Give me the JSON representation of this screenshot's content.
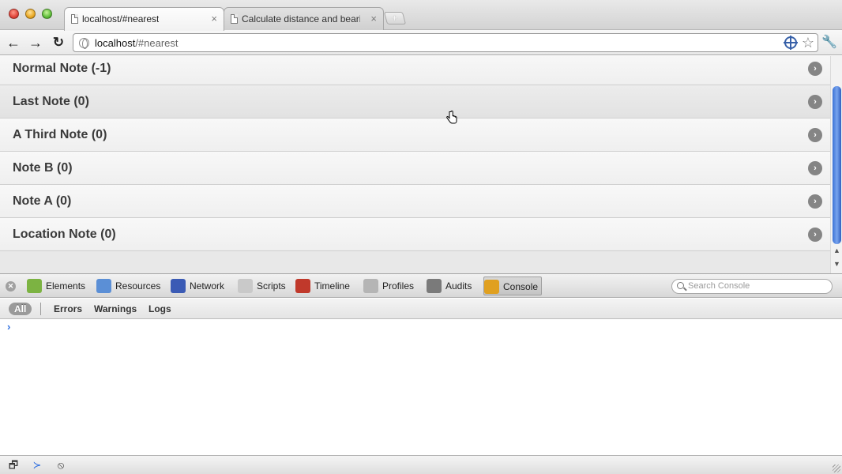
{
  "browser": {
    "tabs": [
      {
        "title": "localhost/#nearest",
        "active": true
      },
      {
        "title": "Calculate distance and bearing",
        "active": false
      }
    ],
    "close_glyph": "×",
    "newtab_glyph": "+",
    "url": {
      "host": "localhost",
      "path": "/#nearest"
    },
    "icons": {
      "back": "back-arrow-icon",
      "forward": "forward-arrow-icon",
      "reload": "reload-icon",
      "wrench": "wrench-icon",
      "star": "star-icon"
    },
    "glyphs": {
      "back": "←",
      "forward": "→",
      "reload": "↻",
      "star": "☆",
      "wrench": "🔧"
    }
  },
  "notes": [
    {
      "label": "Normal Note (-1)"
    },
    {
      "label": "Last Note (0)"
    },
    {
      "label": "A Third Note (0)"
    },
    {
      "label": "Note B (0)"
    },
    {
      "label": "Note A (0)"
    },
    {
      "label": "Location Note (0)"
    }
  ],
  "note_chevron": "›",
  "devtools": {
    "tabs": [
      {
        "label": "Elements",
        "color": "#7cb342"
      },
      {
        "label": "Resources",
        "color": "#5b8fd6"
      },
      {
        "label": "Network",
        "color": "#3b5bb5"
      },
      {
        "label": "Scripts",
        "color": "#c9c9c9"
      },
      {
        "label": "Timeline",
        "color": "#c0392b"
      },
      {
        "label": "Profiles",
        "color": "#b5b5b5"
      },
      {
        "label": "Audits",
        "color": "#7a7a7a"
      },
      {
        "label": "Console",
        "color": "#e0a020"
      }
    ],
    "selected_tab": "Console",
    "search_placeholder": "Search Console",
    "filters": [
      "All",
      "Errors",
      "Warnings",
      "Logs"
    ],
    "prompt": "›"
  },
  "statusbar": {
    "glyphs": {
      "dock": "🗗",
      "drawer": "≻",
      "clear": "⦸"
    }
  },
  "colors": {
    "scroll_thumb": "#3c73d6",
    "console_prompt": "#2f6fe0"
  }
}
